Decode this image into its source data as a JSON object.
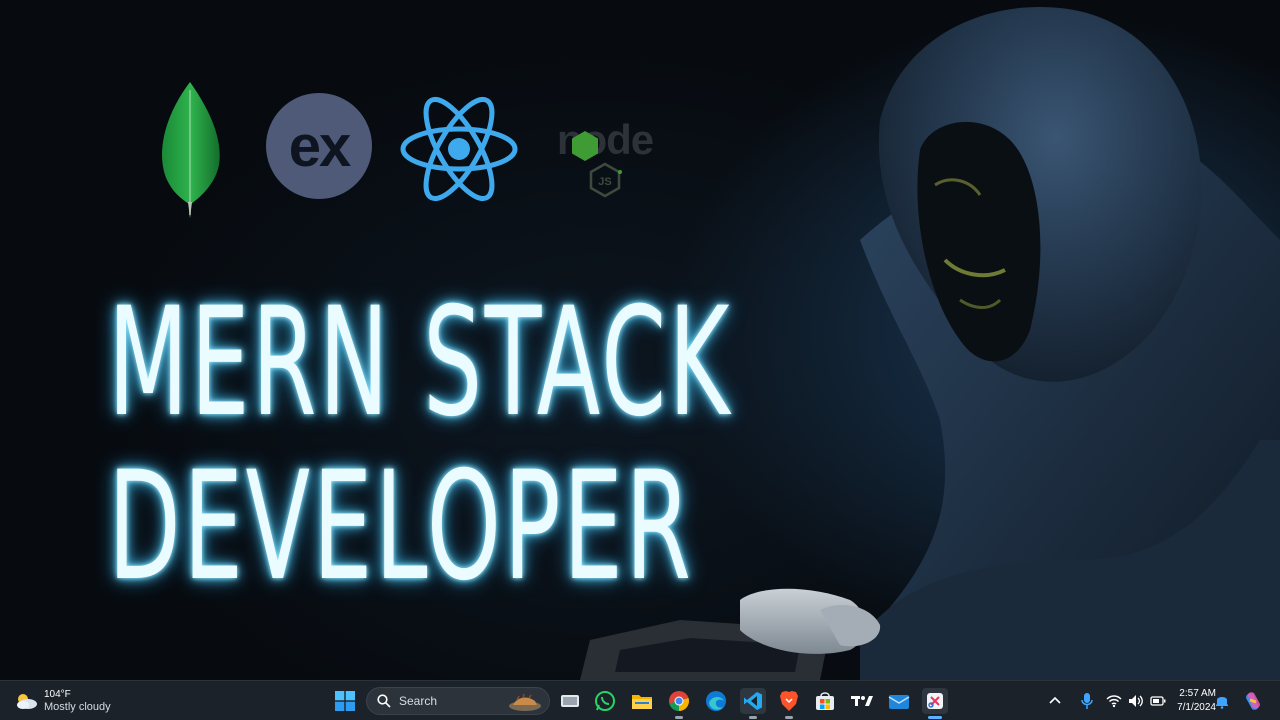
{
  "wallpaper": {
    "logos": {
      "express_text": "ex",
      "node_text": "node",
      "node_js_badge": "JS"
    },
    "title_line1": "MERN STACK",
    "title_line2": "DEVELOPER"
  },
  "taskbar": {
    "weather": {
      "temperature": "104°F",
      "condition": "Mostly cloudy"
    },
    "search": {
      "placeholder": "Search"
    },
    "apps": [
      "start",
      "search",
      "file-explorer-manager",
      "whatsapp",
      "file-explorer",
      "chrome",
      "edge",
      "vscode",
      "brave",
      "microsoft-store",
      "tradingview",
      "mail",
      "snipping-tool"
    ],
    "clock": {
      "time": "2:57 AM",
      "date": "7/1/2024"
    }
  },
  "colors": {
    "title_glow": "#4fc3e8",
    "mongo_green": "#1f9a3f",
    "react_blue": "#3fa9ee",
    "express_bg": "#4e5a78",
    "taskbar_bg": "#1c2229"
  }
}
